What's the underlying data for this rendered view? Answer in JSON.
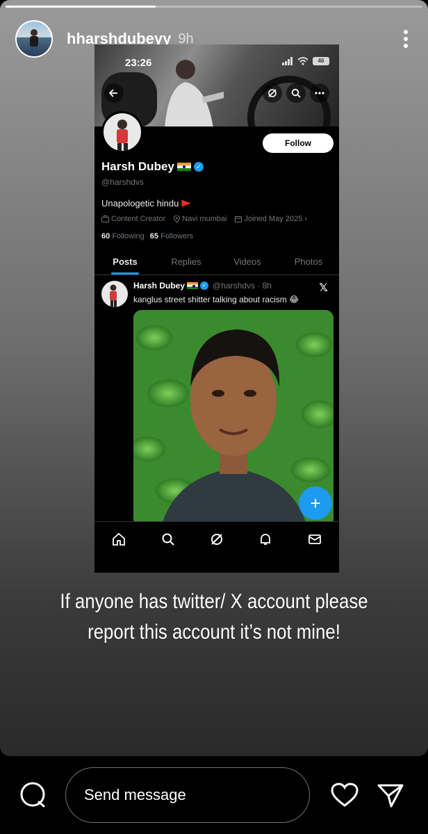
{
  "story": {
    "username": "hharshdubeyy",
    "time_ago": "9h",
    "progress": 0.36,
    "caption_line1": "If anyone has twitter/ X account please",
    "caption_line2": "report this account it’s not mine!"
  },
  "x_screenshot": {
    "status_time": "23:26",
    "battery_label": "46",
    "follow_label": "Follow",
    "profile_name": "Harsh Dubey",
    "handle": "@harshdvs",
    "bio": "Unapologetic hindu",
    "category": "Content Creator",
    "location": "Navi mumbai",
    "joined": "Joined May 2025",
    "following_count": "60",
    "following_label": "Following",
    "followers_count": "65",
    "followers_label": "Followers",
    "tabs": [
      "Posts",
      "Replies",
      "Videos",
      "Photos"
    ],
    "active_tab": "Posts",
    "post": {
      "name": "Harsh Dubey",
      "handle_time": "@harshdvs · 8h",
      "text": "kanglus street shitter talking about racism 😂"
    },
    "accent_color": "#1d9bf0"
  },
  "reply_bar": {
    "placeholder": "Send message"
  }
}
